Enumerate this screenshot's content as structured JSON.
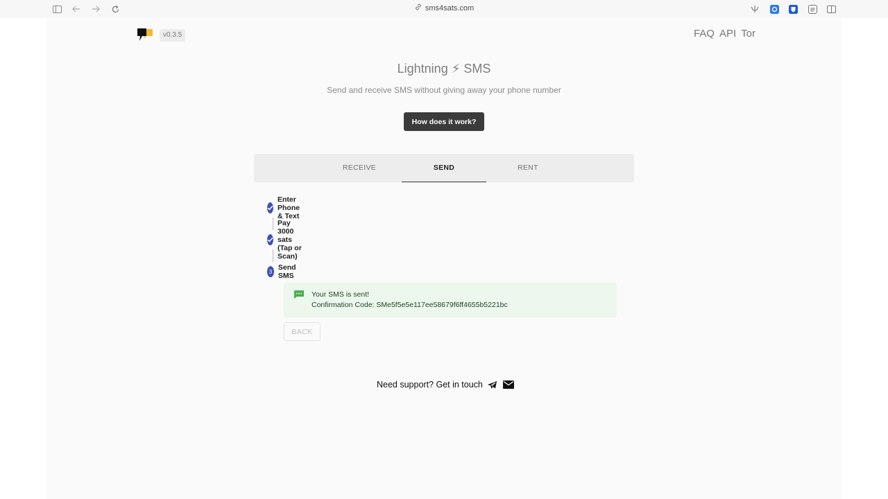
{
  "browser": {
    "url": "sms4sats.com",
    "icons": [
      "sidebar-toggle-icon",
      "back-arrow-icon",
      "forward-arrow-icon",
      "reload-icon",
      "link-icon",
      "extension-icon",
      "bitwarden-icon",
      "reader-icon",
      "split-view-icon"
    ]
  },
  "header": {
    "version": "v0.3.5",
    "nav": [
      "FAQ",
      "API",
      "Tor"
    ]
  },
  "hero": {
    "title": "Lightning ⚡ SMS",
    "subtitle": "Send and receive SMS without giving away your phone number",
    "how_button": "How does it work?"
  },
  "tabs": [
    {
      "label": "RECEIVE",
      "active": false
    },
    {
      "label": "SEND",
      "active": true
    },
    {
      "label": "RENT",
      "active": false
    }
  ],
  "steps": [
    {
      "label": "Enter Phone & Text",
      "state": "completed"
    },
    {
      "label": "Pay 3000 sats (Tap or Scan)",
      "state": "completed"
    },
    {
      "label": "Send SMS",
      "state": "active",
      "number": "3"
    }
  ],
  "alert": {
    "line1": "Your SMS is sent!",
    "line2": "Confirmation Code: SMe5f5e5e117ee58679f6ff4655b5221bc",
    "color": "#edf7ed"
  },
  "back_button": "BACK",
  "support": {
    "text": "Need support? Get in touch"
  },
  "colors": {
    "accent": "#3f51b5",
    "dark_button": "#3b3b3b",
    "success_bg": "#edf7ed",
    "logo_yellow": "#f7b731"
  }
}
